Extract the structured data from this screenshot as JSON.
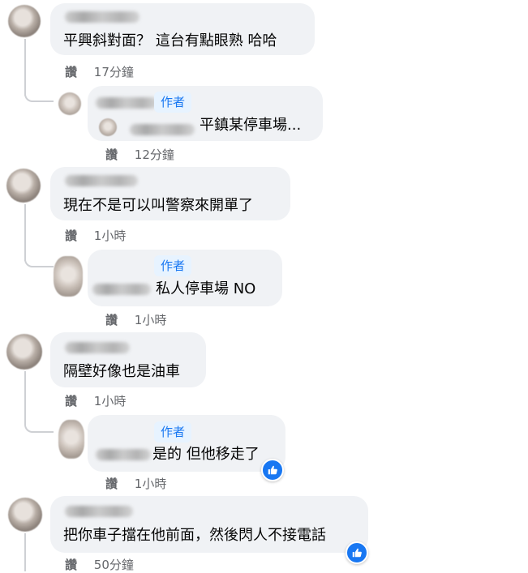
{
  "comments": [
    {
      "text": "平興斜對面？ 這台有點眼熟 哈哈",
      "like_label": "讚",
      "time": "17分鐘",
      "reply": {
        "author_badge": "作者",
        "text": "平鎮某停車場...",
        "like_label": "讚",
        "time": "12分鐘"
      }
    },
    {
      "text": "現在不是可以叫警察來開單了",
      "like_label": "讚",
      "time": "1小時",
      "reply": {
        "author_badge": "作者",
        "text": "私人停車場 NO",
        "like_label": "讚",
        "time": "1小時"
      }
    },
    {
      "text": "隔壁好像也是油車",
      "like_label": "讚",
      "time": "1小時",
      "reply": {
        "author_badge": "作者",
        "text": "是的 但他移走了",
        "like_label": "讚",
        "time": "1小時",
        "reaction": "thumbs-up"
      }
    },
    {
      "text": "把你車子擋在他前面，然後閃人不接電話",
      "like_label": "讚",
      "time": "50分鐘",
      "reaction": "thumbs-up"
    }
  ],
  "colors": {
    "bubble": "#f0f2f5",
    "meta_text": "#65676b",
    "author_badge_bg": "#e7f3ff",
    "author_badge_text": "#1877f2",
    "reaction_blue": "#1877f2"
  }
}
